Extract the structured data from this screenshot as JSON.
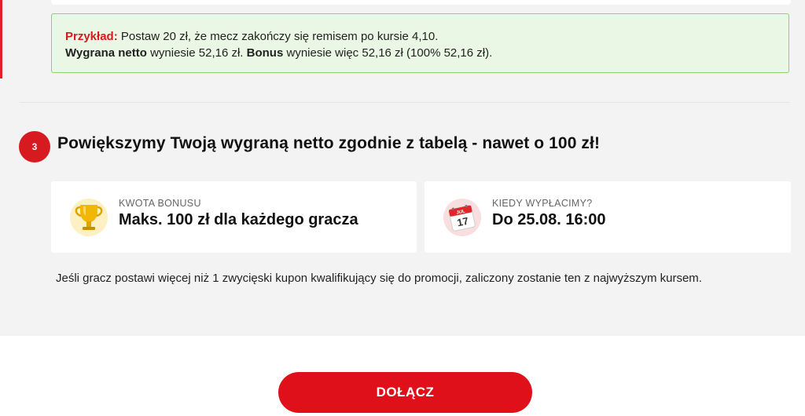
{
  "example": {
    "label": "Przykład:",
    "line1": " Postaw 20 zł, że mecz zakończy się remisem po kursie 4,10.",
    "net_win_label": "Wygrana netto",
    "line2_mid": " wyniesie 52,16 zł. ",
    "bonus_label": "Bonus",
    "line2_end": " wyniesie więc 52,16 zł (100% 52,16 zł)."
  },
  "step": {
    "number": "3",
    "title": "Powiększymy Twoją wygraną netto zgodnie z tabelą - nawet o 100 zł!"
  },
  "cards": [
    {
      "caption": "KWOTA BONUSU",
      "value": "Maks. 100 zł dla każdego gracza",
      "icon": "trophy-icon"
    },
    {
      "caption": "KIEDY WYPŁACIMY?",
      "value": "Do 25.08. 16:00",
      "icon": "calendar-icon",
      "calendar_month": "JUL",
      "calendar_day": "17"
    }
  ],
  "note": "Jeśli gracz postawi więcej niż 1 zwycięski kupon kwalifikujący się do promocji, zaliczony zostanie ten z najwyższym kursem.",
  "join_button": "DOŁĄCZ",
  "colors": {
    "accent_red": "#d71920",
    "example_bg": "#eaf7e4",
    "example_border": "#8fd06f",
    "panel_bg": "#f3f3f4"
  }
}
